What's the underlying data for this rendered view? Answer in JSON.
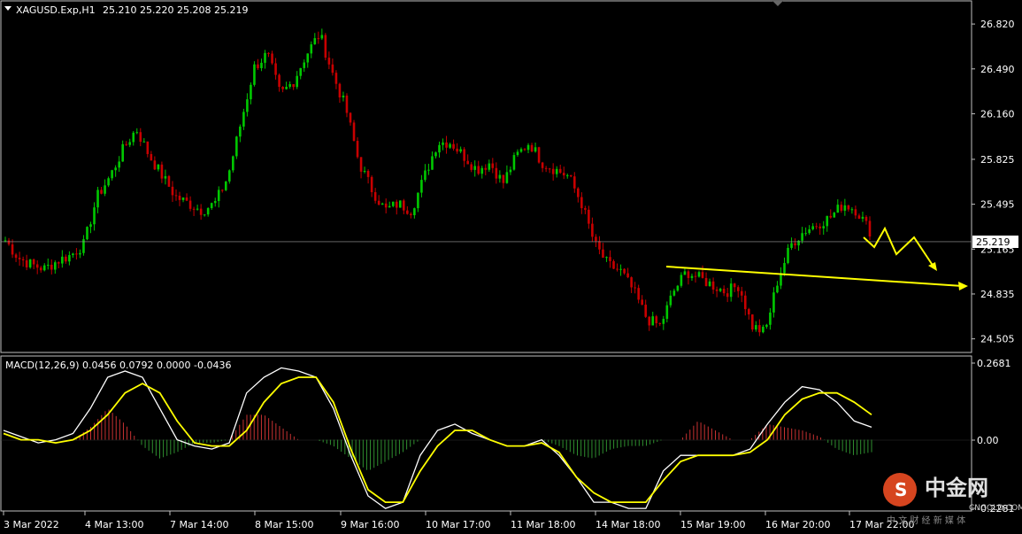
{
  "header": {
    "symbol": "XAGUSD.Exp,H1",
    "ohlc": "25.210 25.220 25.208 25.219",
    "macd_label": "MACD(12,26,9) 0.0456 0.0792 0.0000 -0.0436"
  },
  "price_pane": {
    "ylim": [
      24.405,
      26.99
    ],
    "ticks": [
      "26.820",
      "26.490",
      "26.160",
      "25.825",
      "25.495",
      "25.165",
      "24.835",
      "24.505"
    ],
    "current_price": "25.219",
    "current_value": 25.219
  },
  "macd_pane": {
    "ylim": [
      -0.2281,
      0.2681
    ],
    "ticks": [
      "0.2681",
      "0.00",
      "-0.2281"
    ]
  },
  "x_labels": [
    "3 Mar 2022",
    "4 Mar 13:00",
    "7 Mar 14:00",
    "8 Mar 15:00",
    "9 Mar 16:00",
    "10 Mar 17:00",
    "11 Mar 18:00",
    "14 Mar 18:00",
    "15 Mar 19:00",
    "16 Mar 20:00",
    "17 Mar 22:00"
  ],
  "watermark": {
    "title": "中金网",
    "url": "CNGOLD.COM",
    "tagline": "中 文 财 经 新 媒 体"
  },
  "colors": {
    "background": "#000000",
    "bull_candle": "#00c800",
    "bear_candle": "#c80000",
    "macd_line": "#ffffff",
    "signal_line": "#ffff00",
    "annotation": "#ffff00",
    "grid_line": "#c0c0c0"
  },
  "chart_data": [
    {
      "type": "candlestick",
      "title": "XAGUSD.Exp,H1",
      "xlabel": "",
      "ylabel": "",
      "categories": [
        "3 Mar 2022",
        "4 Mar 13:00",
        "7 Mar 14:00",
        "8 Mar 15:00",
        "9 Mar 16:00",
        "10 Mar 17:00",
        "11 Mar 18:00",
        "14 Mar 18:00",
        "15 Mar 19:00",
        "16 Mar 20:00",
        "17 Mar 22:00"
      ],
      "anchors": [
        25.23,
        25.1,
        25.05,
        25.02,
        25.08,
        25.12,
        25.2,
        25.55,
        25.7,
        25.9,
        26.05,
        25.85,
        25.7,
        25.55,
        25.5,
        25.45,
        25.5,
        25.7,
        26.1,
        26.5,
        26.6,
        26.3,
        26.4,
        26.6,
        26.75,
        26.45,
        26.2,
        25.8,
        25.6,
        25.45,
        25.5,
        25.45,
        25.7,
        25.95,
        25.95,
        25.85,
        25.75,
        25.8,
        25.65,
        25.85,
        25.95,
        25.8,
        25.75,
        25.7,
        25.5,
        25.2,
        25.05,
        25.0,
        24.85,
        24.65,
        24.6,
        24.85,
        25.0,
        24.95,
        24.9,
        24.85,
        24.9,
        24.6,
        24.55,
        24.95,
        25.2,
        25.3,
        25.35,
        25.4,
        25.5,
        25.45,
        25.3
      ],
      "ylim": [
        24.405,
        26.99
      ]
    },
    {
      "type": "line",
      "title": "MACD(12,26,9) 0.0456 0.0792 0.0000 -0.0436",
      "series": [
        {
          "name": "MACD",
          "values": [
            0.03,
            0.01,
            -0.01,
            0.0,
            0.02,
            0.1,
            0.2,
            0.22,
            0.2,
            0.1,
            0.0,
            -0.02,
            -0.03,
            -0.01,
            0.15,
            0.2,
            0.23,
            0.22,
            0.2,
            0.1,
            -0.05,
            -0.18,
            -0.22,
            -0.2,
            -0.05,
            0.03,
            0.05,
            0.02,
            0.0,
            -0.02,
            -0.02,
            0.0,
            -0.05,
            -0.12,
            -0.2,
            -0.2,
            -0.22,
            -0.22,
            -0.1,
            -0.05,
            -0.05,
            -0.05,
            -0.05,
            -0.03,
            0.05,
            0.12,
            0.17,
            0.16,
            0.12,
            0.06,
            0.04
          ]
        },
        {
          "name": "Signal",
          "values": [
            0.02,
            0.0,
            0.0,
            -0.01,
            0.0,
            0.03,
            0.08,
            0.15,
            0.18,
            0.15,
            0.06,
            -0.01,
            -0.02,
            -0.02,
            0.03,
            0.12,
            0.18,
            0.2,
            0.2,
            0.12,
            -0.03,
            -0.16,
            -0.2,
            -0.2,
            -0.1,
            -0.02,
            0.03,
            0.03,
            0.0,
            -0.02,
            -0.02,
            -0.01,
            -0.04,
            -0.12,
            -0.17,
            -0.2,
            -0.2,
            -0.2,
            -0.13,
            -0.07,
            -0.05,
            -0.05,
            -0.05,
            -0.04,
            0.0,
            0.08,
            0.13,
            0.15,
            0.15,
            0.12,
            0.08
          ]
        },
        {
          "name": "Histogram",
          "values": [
            0.0,
            0.0,
            0.0,
            0.0,
            0.0,
            0.04,
            0.1,
            0.05,
            -0.02,
            -0.06,
            -0.04,
            -0.01,
            -0.01,
            0.0,
            0.08,
            0.08,
            0.04,
            0.0,
            0.0,
            -0.02,
            -0.06,
            -0.1,
            -0.07,
            -0.04,
            0.0,
            0.0,
            0.0,
            0.0,
            0.0,
            0.0,
            0.0,
            0.0,
            -0.02,
            -0.05,
            -0.06,
            -0.03,
            -0.02,
            -0.02,
            0.0,
            0.0,
            0.06,
            0.03,
            0.0,
            0.0,
            0.05,
            0.04,
            0.03,
            0.01,
            -0.03,
            -0.05,
            -0.04
          ]
        }
      ],
      "ylim": [
        -0.2281,
        0.2681
      ]
    }
  ]
}
